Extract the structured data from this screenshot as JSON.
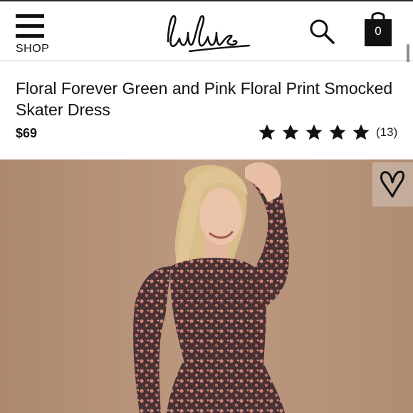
{
  "header": {
    "menu_label": "SHOP",
    "logo_text": "Lulus",
    "bag_count": "0"
  },
  "product": {
    "title": "Floral Forever Green and Pink Floral Print Smocked Skater Dress",
    "price": "$69",
    "rating": 5,
    "review_count": "(13)"
  },
  "colors": {
    "background": "#b8937a",
    "dress_base": "#4a2f33",
    "dress_flowers": "#c98876",
    "icon": "#111111"
  },
  "icons": {
    "menu": "hamburger-icon",
    "search": "search-icon",
    "bag": "shopping-bag-icon",
    "wishlist": "heart-icon"
  }
}
